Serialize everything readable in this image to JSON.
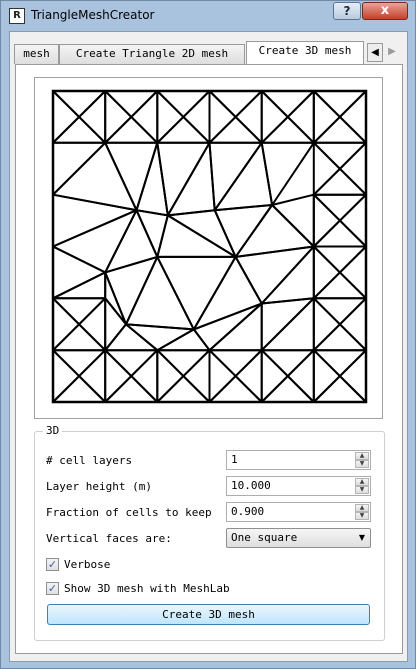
{
  "window": {
    "title": "TriangleMeshCreator",
    "app_icon_text": "R",
    "help_label": "?",
    "close_label": "x"
  },
  "tabs": [
    {
      "label": "mesh"
    },
    {
      "label": "Create Triangle 2D mesh"
    },
    {
      "label": "Create 3D mesh"
    }
  ],
  "tab_scroll": {
    "left": "◀",
    "right": "▶"
  },
  "group": {
    "title": "3D",
    "cell_layers_label": "# cell layers",
    "cell_layers_value": "1",
    "layer_height_label": "Layer height (m)",
    "layer_height_value": "10.000",
    "fraction_label": "Fraction of cells to keep",
    "fraction_value": "0.900",
    "vertical_faces_label": "Vertical faces are:",
    "vertical_faces_value": "One square",
    "verbose_label": "Verbose",
    "verbose_checked": true,
    "meshlab_label": "Show 3D mesh with MeshLab",
    "meshlab_checked": true,
    "create_button_label": "Create 3D mesh"
  },
  "mesh": {
    "grid_lines": [
      0,
      1,
      2,
      3,
      4,
      5,
      6
    ],
    "triangles": [
      [
        [
          0,
          0
        ],
        [
          1,
          0
        ],
        [
          0.5,
          0.5
        ]
      ],
      [
        [
          1,
          0
        ],
        [
          1,
          1
        ],
        [
          0.5,
          0.5
        ]
      ],
      [
        [
          1,
          1
        ],
        [
          0,
          1
        ],
        [
          0.5,
          0.5
        ]
      ],
      [
        [
          0,
          1
        ],
        [
          0,
          0
        ],
        [
          0.5,
          0.5
        ]
      ],
      [
        [
          1,
          0
        ],
        [
          2,
          0
        ],
        [
          1.5,
          0.5
        ]
      ],
      [
        [
          2,
          0
        ],
        [
          2,
          1
        ],
        [
          1.5,
          0.5
        ]
      ],
      [
        [
          2,
          1
        ],
        [
          1,
          1
        ],
        [
          1.5,
          0.5
        ]
      ],
      [
        [
          1,
          1
        ],
        [
          1,
          0
        ],
        [
          1.5,
          0.5
        ]
      ],
      [
        [
          2,
          0
        ],
        [
          3,
          0
        ],
        [
          2.5,
          0.5
        ]
      ],
      [
        [
          3,
          0
        ],
        [
          3,
          1
        ],
        [
          2.5,
          0.5
        ]
      ],
      [
        [
          3,
          1
        ],
        [
          2,
          1
        ],
        [
          2.5,
          0.5
        ]
      ],
      [
        [
          2,
          1
        ],
        [
          2,
          0
        ],
        [
          2.5,
          0.5
        ]
      ],
      [
        [
          3,
          0
        ],
        [
          4,
          0
        ],
        [
          3.5,
          0.5
        ]
      ],
      [
        [
          4,
          0
        ],
        [
          4,
          1
        ],
        [
          3.5,
          0.5
        ]
      ],
      [
        [
          4,
          1
        ],
        [
          3,
          1
        ],
        [
          3.5,
          0.5
        ]
      ],
      [
        [
          3,
          1
        ],
        [
          3,
          0
        ],
        [
          3.5,
          0.5
        ]
      ],
      [
        [
          4,
          0
        ],
        [
          5,
          0
        ],
        [
          4.5,
          0.5
        ]
      ],
      [
        [
          5,
          0
        ],
        [
          5,
          1
        ],
        [
          4.5,
          0.5
        ]
      ],
      [
        [
          5,
          1
        ],
        [
          4,
          1
        ],
        [
          4.5,
          0.5
        ]
      ],
      [
        [
          4,
          1
        ],
        [
          4,
          0
        ],
        [
          4.5,
          0.5
        ]
      ],
      [
        [
          5,
          0
        ],
        [
          6,
          0
        ],
        [
          5.5,
          0.5
        ]
      ],
      [
        [
          6,
          0
        ],
        [
          6,
          1
        ],
        [
          5.5,
          0.5
        ]
      ],
      [
        [
          6,
          1
        ],
        [
          5,
          1
        ],
        [
          5.5,
          0.5
        ]
      ],
      [
        [
          5,
          1
        ],
        [
          5,
          0
        ],
        [
          5.5,
          0.5
        ]
      ],
      [
        [
          0,
          1
        ],
        [
          1,
          1
        ],
        [
          0,
          2
        ]
      ],
      [
        [
          1,
          1
        ],
        [
          1.6,
          2.3
        ],
        [
          0,
          2
        ]
      ],
      [
        [
          1,
          1
        ],
        [
          2,
          1
        ],
        [
          1.6,
          2.3
        ]
      ],
      [
        [
          2,
          1
        ],
        [
          3,
          1
        ],
        [
          2.2,
          2.4
        ]
      ],
      [
        [
          2,
          1
        ],
        [
          2.2,
          2.4
        ],
        [
          1.6,
          2.3
        ]
      ],
      [
        [
          3,
          1
        ],
        [
          3.1,
          2.3
        ],
        [
          2.2,
          2.4
        ]
      ],
      [
        [
          3,
          1
        ],
        [
          4,
          1
        ],
        [
          3.1,
          2.3
        ]
      ],
      [
        [
          4,
          1
        ],
        [
          4.2,
          2.2
        ],
        [
          3.1,
          2.3
        ]
      ],
      [
        [
          4,
          1
        ],
        [
          5,
          1
        ],
        [
          4.2,
          2.2
        ]
      ],
      [
        [
          5,
          1
        ],
        [
          6,
          1
        ],
        [
          5.5,
          1.5
        ]
      ],
      [
        [
          6,
          1
        ],
        [
          6,
          2
        ],
        [
          5.5,
          1.5
        ]
      ],
      [
        [
          6,
          2
        ],
        [
          5,
          2
        ],
        [
          5.5,
          1.5
        ]
      ],
      [
        [
          5,
          2
        ],
        [
          5,
          1
        ],
        [
          5.5,
          1.5
        ]
      ],
      [
        [
          0,
          2
        ],
        [
          1.6,
          2.3
        ],
        [
          0,
          3
        ]
      ],
      [
        [
          0,
          3
        ],
        [
          1.6,
          2.3
        ],
        [
          1,
          3.5
        ]
      ],
      [
        [
          1.6,
          2.3
        ],
        [
          2.2,
          2.4
        ],
        [
          2,
          3.2
        ]
      ],
      [
        [
          1.6,
          2.3
        ],
        [
          2,
          3.2
        ],
        [
          1,
          3.5
        ]
      ],
      [
        [
          2.2,
          2.4
        ],
        [
          3.1,
          2.3
        ],
        [
          3.5,
          3.2
        ]
      ],
      [
        [
          2.2,
          2.4
        ],
        [
          3.5,
          3.2
        ],
        [
          2,
          3.2
        ]
      ],
      [
        [
          3.1,
          2.3
        ],
        [
          4.2,
          2.2
        ],
        [
          3.5,
          3.2
        ]
      ],
      [
        [
          4.2,
          2.2
        ],
        [
          5,
          2
        ],
        [
          5,
          3
        ]
      ],
      [
        [
          4.2,
          2.2
        ],
        [
          5,
          3
        ],
        [
          3.5,
          3.2
        ]
      ],
      [
        [
          5,
          2
        ],
        [
          6,
          2
        ],
        [
          5.5,
          2.5
        ]
      ],
      [
        [
          6,
          2
        ],
        [
          6,
          3
        ],
        [
          5.5,
          2.5
        ]
      ],
      [
        [
          6,
          3
        ],
        [
          5,
          3
        ],
        [
          5.5,
          2.5
        ]
      ],
      [
        [
          5,
          3
        ],
        [
          5,
          2
        ],
        [
          5.5,
          2.5
        ]
      ],
      [
        [
          0,
          3
        ],
        [
          1,
          3.5
        ],
        [
          0,
          4
        ]
      ],
      [
        [
          0,
          4
        ],
        [
          1,
          3.5
        ],
        [
          1,
          4
        ]
      ],
      [
        [
          1,
          3.5
        ],
        [
          2,
          3.2
        ],
        [
          1.4,
          4.5
        ]
      ],
      [
        [
          1,
          3.5
        ],
        [
          1.4,
          4.5
        ],
        [
          1,
          4
        ]
      ],
      [
        [
          2,
          3.2
        ],
        [
          2.7,
          4.6
        ],
        [
          1.4,
          4.5
        ]
      ],
      [
        [
          2,
          3.2
        ],
        [
          3.5,
          3.2
        ],
        [
          2.7,
          4.6
        ]
      ],
      [
        [
          3.5,
          3.2
        ],
        [
          4,
          4.1
        ],
        [
          2.7,
          4.6
        ]
      ],
      [
        [
          3.5,
          3.2
        ],
        [
          5,
          3
        ],
        [
          4,
          4.1
        ]
      ],
      [
        [
          5,
          3
        ],
        [
          5,
          4
        ],
        [
          4,
          4.1
        ]
      ],
      [
        [
          5,
          3
        ],
        [
          6,
          3
        ],
        [
          5.5,
          3.5
        ]
      ],
      [
        [
          6,
          3
        ],
        [
          6,
          4
        ],
        [
          5.5,
          3.5
        ]
      ],
      [
        [
          6,
          4
        ],
        [
          5,
          4
        ],
        [
          5.5,
          3.5
        ]
      ],
      [
        [
          5,
          4
        ],
        [
          5,
          3
        ],
        [
          5.5,
          3.5
        ]
      ],
      [
        [
          0,
          4
        ],
        [
          1,
          4
        ],
        [
          0.5,
          4.5
        ]
      ],
      [
        [
          1,
          4
        ],
        [
          1,
          5
        ],
        [
          0.5,
          4.5
        ]
      ],
      [
        [
          1,
          5
        ],
        [
          0,
          5
        ],
        [
          0.5,
          4.5
        ]
      ],
      [
        [
          0,
          5
        ],
        [
          0,
          4
        ],
        [
          0.5,
          4.5
        ]
      ],
      [
        [
          1,
          4
        ],
        [
          1.4,
          4.5
        ],
        [
          1,
          5
        ]
      ],
      [
        [
          1,
          5
        ],
        [
          1.4,
          4.5
        ],
        [
          2,
          5
        ]
      ],
      [
        [
          1.4,
          4.5
        ],
        [
          2.7,
          4.6
        ],
        [
          2,
          5
        ]
      ],
      [
        [
          2,
          5
        ],
        [
          2.7,
          4.6
        ],
        [
          3,
          5
        ]
      ],
      [
        [
          2.7,
          4.6
        ],
        [
          4,
          4.1
        ],
        [
          3,
          5
        ]
      ],
      [
        [
          3,
          5
        ],
        [
          4,
          4.1
        ],
        [
          4,
          5
        ]
      ],
      [
        [
          4,
          4.1
        ],
        [
          5,
          4
        ],
        [
          4,
          5
        ]
      ],
      [
        [
          4,
          5
        ],
        [
          5,
          4
        ],
        [
          5,
          5
        ]
      ],
      [
        [
          5,
          4
        ],
        [
          6,
          4
        ],
        [
          5.5,
          4.5
        ]
      ],
      [
        [
          6,
          4
        ],
        [
          6,
          5
        ],
        [
          5.5,
          4.5
        ]
      ],
      [
        [
          6,
          5
        ],
        [
          5,
          5
        ],
        [
          5.5,
          4.5
        ]
      ],
      [
        [
          5,
          5
        ],
        [
          5,
          4
        ],
        [
          5.5,
          4.5
        ]
      ],
      [
        [
          0,
          5
        ],
        [
          1,
          5
        ],
        [
          0.5,
          5.5
        ]
      ],
      [
        [
          1,
          5
        ],
        [
          1,
          6
        ],
        [
          0.5,
          5.5
        ]
      ],
      [
        [
          1,
          6
        ],
        [
          0,
          6
        ],
        [
          0.5,
          5.5
        ]
      ],
      [
        [
          0,
          6
        ],
        [
          0,
          5
        ],
        [
          0.5,
          5.5
        ]
      ],
      [
        [
          1,
          5
        ],
        [
          2,
          5
        ],
        [
          1.5,
          5.5
        ]
      ],
      [
        [
          2,
          5
        ],
        [
          2,
          6
        ],
        [
          1.5,
          5.5
        ]
      ],
      [
        [
          2,
          6
        ],
        [
          1,
          6
        ],
        [
          1.5,
          5.5
        ]
      ],
      [
        [
          1,
          6
        ],
        [
          1,
          5
        ],
        [
          1.5,
          5.5
        ]
      ],
      [
        [
          2,
          5
        ],
        [
          3,
          5
        ],
        [
          2.5,
          5.5
        ]
      ],
      [
        [
          3,
          5
        ],
        [
          3,
          6
        ],
        [
          2.5,
          5.5
        ]
      ],
      [
        [
          3,
          6
        ],
        [
          2,
          6
        ],
        [
          2.5,
          5.5
        ]
      ],
      [
        [
          2,
          6
        ],
        [
          2,
          5
        ],
        [
          2.5,
          5.5
        ]
      ],
      [
        [
          3,
          5
        ],
        [
          4,
          5
        ],
        [
          3.5,
          5.5
        ]
      ],
      [
        [
          4,
          5
        ],
        [
          4,
          6
        ],
        [
          3.5,
          5.5
        ]
      ],
      [
        [
          4,
          6
        ],
        [
          3,
          6
        ],
        [
          3.5,
          5.5
        ]
      ],
      [
        [
          3,
          6
        ],
        [
          3,
          5
        ],
        [
          3.5,
          5.5
        ]
      ],
      [
        [
          4,
          5
        ],
        [
          5,
          5
        ],
        [
          4.5,
          5.5
        ]
      ],
      [
        [
          5,
          5
        ],
        [
          5,
          6
        ],
        [
          4.5,
          5.5
        ]
      ],
      [
        [
          5,
          6
        ],
        [
          4,
          6
        ],
        [
          4.5,
          5.5
        ]
      ],
      [
        [
          4,
          6
        ],
        [
          4,
          5
        ],
        [
          4.5,
          5.5
        ]
      ],
      [
        [
          5,
          5
        ],
        [
          6,
          5
        ],
        [
          5.5,
          5.5
        ]
      ],
      [
        [
          6,
          5
        ],
        [
          6,
          6
        ],
        [
          5.5,
          5.5
        ]
      ],
      [
        [
          6,
          6
        ],
        [
          5,
          6
        ],
        [
          5.5,
          5.5
        ]
      ],
      [
        [
          5,
          6
        ],
        [
          5,
          5
        ],
        [
          5.5,
          5.5
        ]
      ]
    ]
  }
}
